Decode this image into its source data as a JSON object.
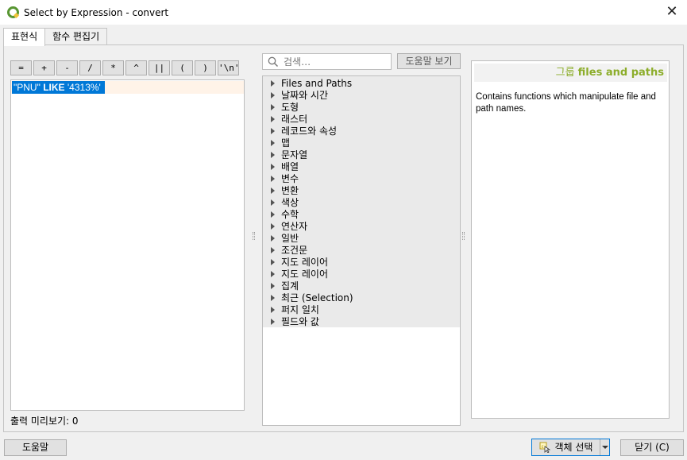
{
  "window": {
    "title": "Select by Expression - convert",
    "close_glyph": "✕"
  },
  "tabs": [
    {
      "label": "표현식",
      "active": true
    },
    {
      "label": "함수 편집기",
      "active": false
    }
  ],
  "operators": [
    "=",
    "+",
    "-",
    "/",
    "*",
    "^",
    "||",
    "(",
    ")",
    "'\\n'"
  ],
  "expression": {
    "field": "\"PNU\" ",
    "keyword": "LIKE",
    "value": " '4313%' "
  },
  "preview": {
    "label": "출력 미리보기: 0"
  },
  "search": {
    "placeholder": "검색…"
  },
  "help_button_top": "도움말 보기",
  "function_groups": [
    "Files and Paths",
    "날짜와 시간",
    "도형",
    "래스터",
    "레코드와 속성",
    "맵",
    "문자열",
    "배열",
    "변수",
    "변환",
    "색상",
    "수학",
    "연산자",
    "일반",
    "조건문",
    "지도 레이어",
    "지도 레이어",
    "집계",
    "최근 (Selection)",
    "퍼지 일치",
    "필드와 값"
  ],
  "help_panel": {
    "header_prefix": "그룹 ",
    "header_name": "files and paths",
    "body": "Contains functions which manipulate file and path names."
  },
  "buttons": {
    "help": "도움말",
    "select_features": "객체 선택",
    "close": "닫기 (C)"
  },
  "colors": {
    "accent": "#0078d7",
    "help_header": "#8cad2a",
    "qgis_green": "#589632"
  },
  "icons": {
    "app": "qgis-logo-icon",
    "search": "search-icon",
    "select": "select-by-expression-icon"
  }
}
